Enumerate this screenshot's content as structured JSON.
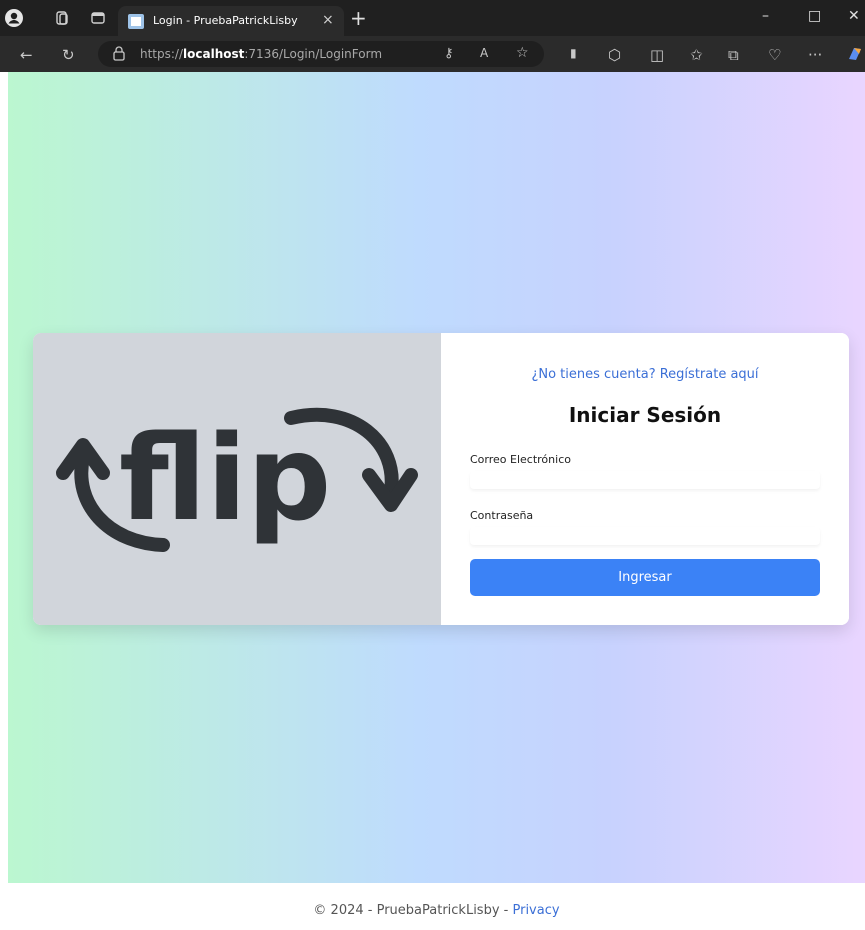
{
  "browser": {
    "tab_title": "Login - PruebaPatrickLisby",
    "url_prefix": "https://",
    "url_host": "localhost",
    "url_rest": ":7136/Login/LoginForm",
    "new_tab_glyph": "+",
    "close_tab_glyph": "×",
    "more_glyph": "···",
    "window_controls": {
      "minimize": "–",
      "maximize": "□",
      "close": "✕"
    }
  },
  "logo": {
    "text": "flip",
    "color": "#2f3337"
  },
  "login": {
    "register_link": "¿No tienes cuenta? Regístrate aquí",
    "title": "Iniciar Sesión",
    "email_label": "Correo Electrónico",
    "email_value": "",
    "password_label": "Contraseña",
    "password_value": "",
    "submit_label": "Ingresar"
  },
  "footer": {
    "copyright": "© 2024 - PruebaPatrickLisby - ",
    "privacy_link": "Privacy"
  },
  "colors": {
    "accent": "#3b82f6",
    "link": "#3b6fd6",
    "gradient_start": "#bbf7d0",
    "gradient_mid": "#bfdbfe",
    "gradient_end": "#e9d5ff"
  }
}
